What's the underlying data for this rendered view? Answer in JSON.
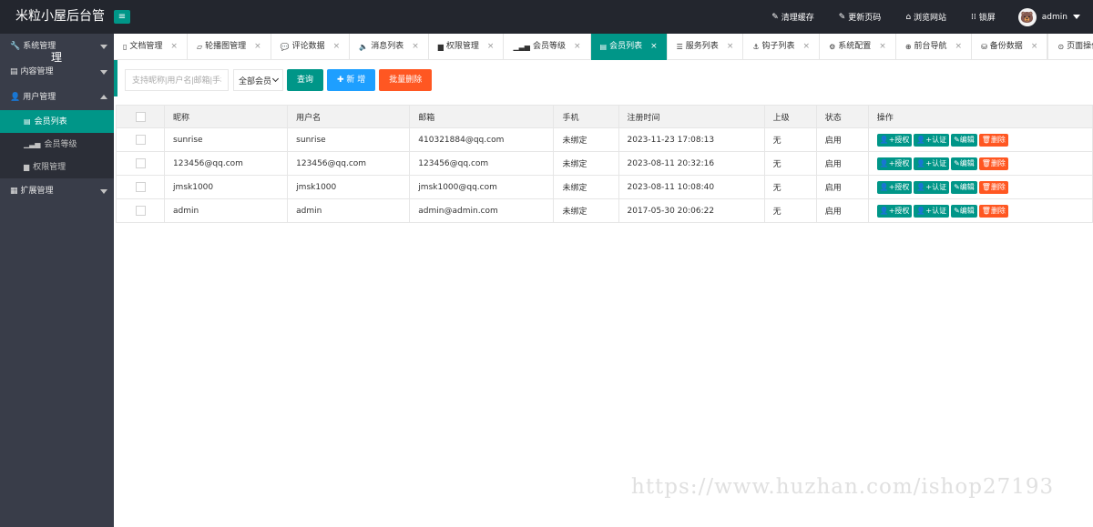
{
  "app": {
    "title": "米粒小屋后台管",
    "menu_toggle_glyph": "≡",
    "accent_color": "#009688"
  },
  "header": {
    "links": [
      {
        "icon": "eraser-icon",
        "glyph": "✎",
        "label": "清理缓存"
      },
      {
        "icon": "refresh-icon",
        "glyph": "✎",
        "label": "更新页码"
      },
      {
        "icon": "home-icon",
        "glyph": "⌂",
        "label": "浏览网站"
      },
      {
        "icon": "lock-icon",
        "glyph": "⁞⁞",
        "label": "锁屏"
      }
    ],
    "user": "admin"
  },
  "sidebar": {
    "extra_char": "理",
    "groups": [
      {
        "glyph": "🔧",
        "label": "系统管理",
        "expanded": false
      },
      {
        "glyph": "▤",
        "label": "内容管理",
        "expanded": false
      },
      {
        "glyph": "👤",
        "label": "用户管理",
        "expanded": true,
        "items": [
          {
            "glyph": "▤",
            "label": "会员列表",
            "active": true
          },
          {
            "glyph": "▁▃▅",
            "label": "会员等级",
            "active": false
          },
          {
            "glyph": "▆",
            "label": "权限管理",
            "active": false
          }
        ]
      },
      {
        "glyph": "▦",
        "label": "扩展管理",
        "expanded": false
      }
    ]
  },
  "tabs": [
    {
      "glyph": "▯",
      "label": "文档管理"
    },
    {
      "glyph": "▱",
      "label": "轮播图管理"
    },
    {
      "glyph": "💬",
      "label": "评论数据"
    },
    {
      "glyph": "🔈",
      "label": "消息列表"
    },
    {
      "glyph": "▆",
      "label": "权限管理"
    },
    {
      "glyph": "▁▃▅",
      "label": "会员等级"
    },
    {
      "glyph": "▤",
      "label": "会员列表",
      "active": true
    },
    {
      "glyph": "☰",
      "label": "服务列表"
    },
    {
      "glyph": "⚓",
      "label": "钩子列表"
    },
    {
      "glyph": "⚙",
      "label": "系统配置"
    },
    {
      "glyph": "⊕",
      "label": "前台导航"
    },
    {
      "glyph": "⛁",
      "label": "备份数据"
    }
  ],
  "tab_close_glyph": "×",
  "page_ops": {
    "glyph": "⊙",
    "label": "页面操作"
  },
  "toolbar": {
    "search_placeholder": "支持昵称|用户名|邮箱|手机",
    "filter_value": "全部会员",
    "query_label": "查询",
    "add_label": "✚ 新 增",
    "batch_delete_label": "批量删除"
  },
  "table": {
    "columns": [
      "昵称",
      "用户名",
      "邮箱",
      "手机",
      "注册时间",
      "上级",
      "状态",
      "操作"
    ],
    "rows": [
      {
        "nickname": "sunrise",
        "username": "sunrise",
        "email": "410321884@qq.com",
        "phone": "未绑定",
        "registered": "2023-11-23 17:08:13",
        "parent": "无",
        "status": "启用"
      },
      {
        "nickname": "123456@qq.com",
        "username": "123456@qq.com",
        "email": "123456@qq.com",
        "phone": "未绑定",
        "registered": "2023-08-11 20:32:16",
        "parent": "无",
        "status": "启用"
      },
      {
        "nickname": "jmsk1000",
        "username": "jmsk1000",
        "email": "jmsk1000@qq.com",
        "phone": "未绑定",
        "registered": "2023-08-11 10:08:40",
        "parent": "无",
        "status": "启用"
      },
      {
        "nickname": "admin",
        "username": "admin",
        "email": "admin@admin.com",
        "phone": "未绑定",
        "registered": "2017-05-30 20:06:22",
        "parent": "无",
        "status": "启用"
      }
    ],
    "actions": [
      {
        "name": "authorize",
        "label": "👤+授权",
        "color": "#009688"
      },
      {
        "name": "verify",
        "label": "👤+认证",
        "color": "#009688"
      },
      {
        "name": "edit",
        "label": "✎编辑",
        "color": "#009688"
      },
      {
        "name": "delete",
        "label": "🗑删除",
        "color": "#ff5722"
      }
    ]
  },
  "watermark": "https://www.huzhan.com/ishop27193"
}
